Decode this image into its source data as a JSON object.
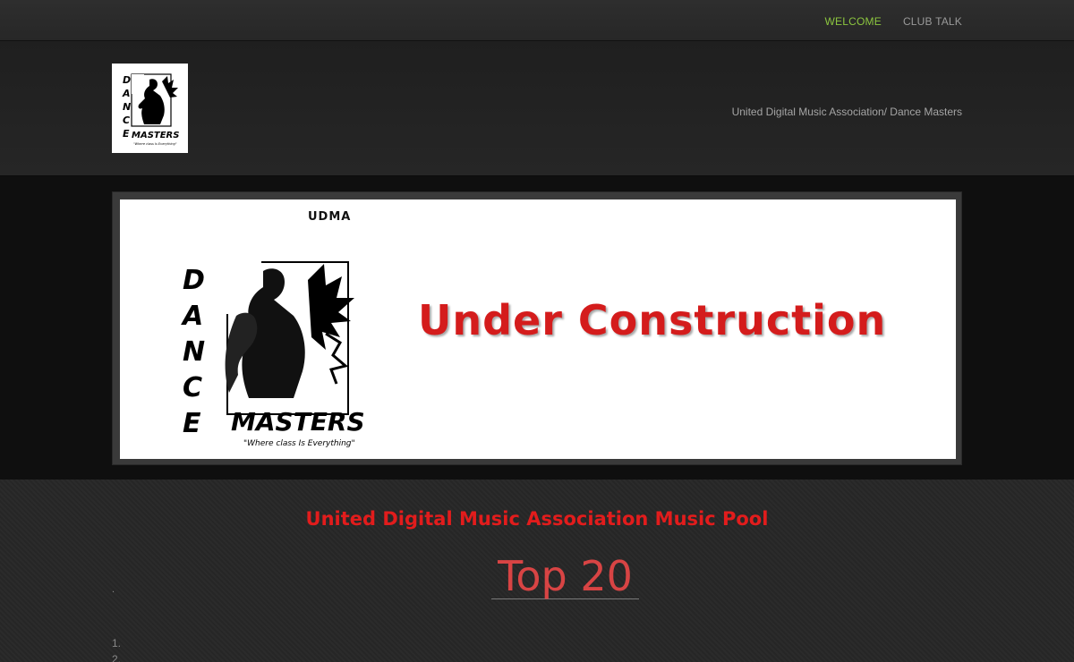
{
  "nav": {
    "items": [
      {
        "label": "WELCOME",
        "active": true
      },
      {
        "label": "CLUB TALK",
        "active": false
      }
    ],
    "active_color": "#8cc63f"
  },
  "header": {
    "tagline": "United Digital Music Association/ Dance Masters"
  },
  "banner": {
    "badge": "UDMA",
    "logo_text_vertical": "DANCE",
    "logo_text_bottom": "MASTERS",
    "logo_slogan": "“Where class Is Everything”",
    "headline": "Under Construction",
    "headline_color": "#d41c1c"
  },
  "content": {
    "pool_title": "United Digital Music Association Music Pool",
    "top_title": "Top 20",
    "dot": ".",
    "list": [
      "1.",
      "2."
    ]
  }
}
